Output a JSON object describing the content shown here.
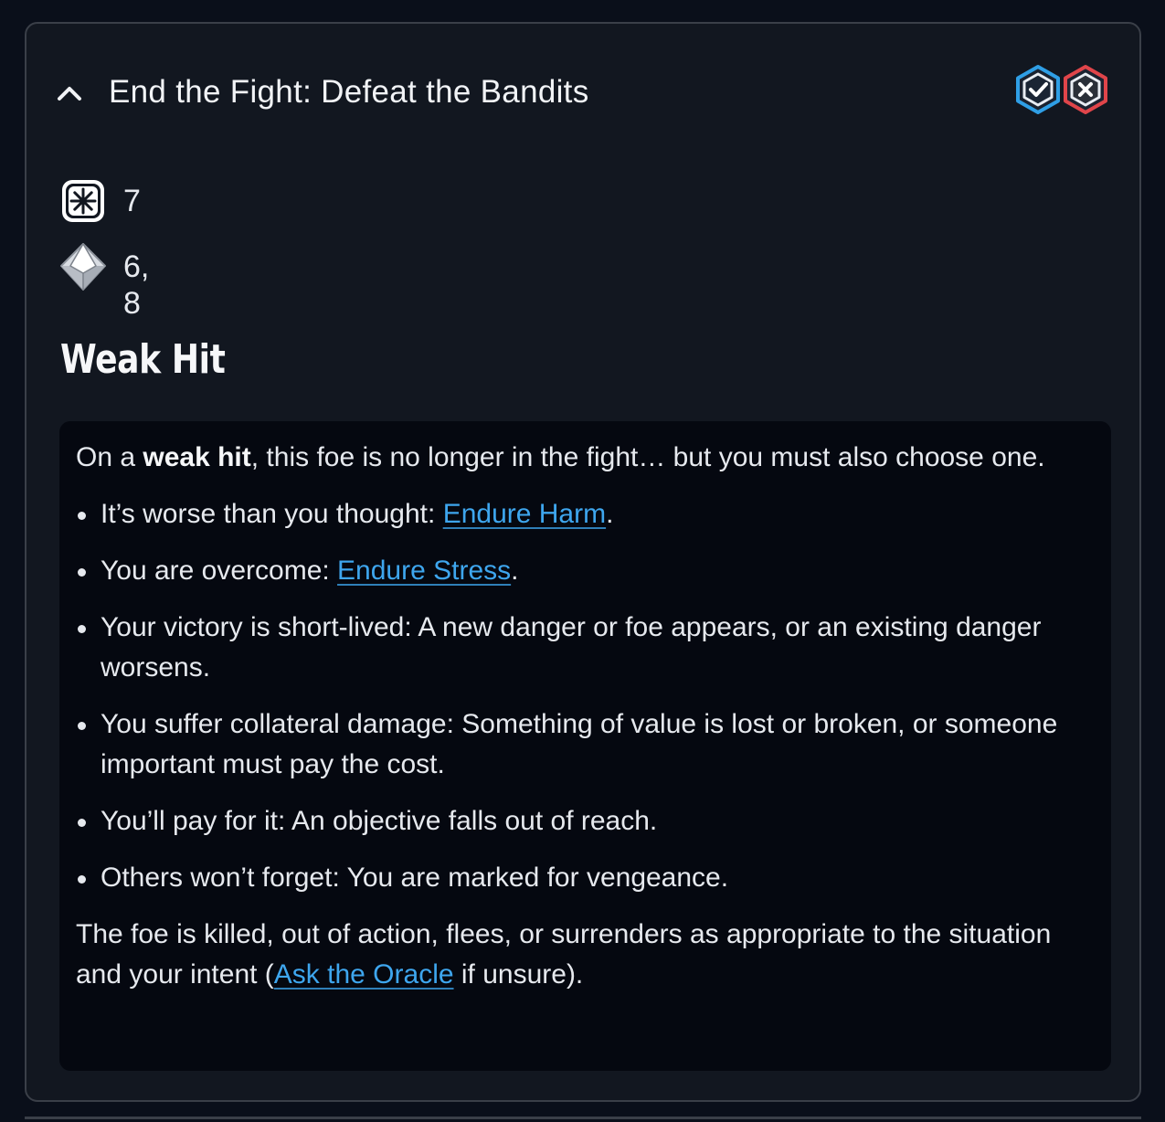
{
  "move": {
    "title": "End the Fight: Defeat the Bandits"
  },
  "actions": {
    "confirm_icon": "hex-check-icon",
    "dismiss_icon": "hex-x-icon",
    "confirm_color": "#2f9fe6",
    "dismiss_color": "#e0454a"
  },
  "roll": {
    "action_die_icon": "action-die-icon",
    "action_value": "7",
    "challenge_die_icon": "challenge-die-icon",
    "challenge_values": "6, 8"
  },
  "outcome": {
    "heading": "Weak Hit",
    "intro_prefix": "On a ",
    "intro_bold": "weak hit",
    "intro_suffix": ", this foe is no longer in the fight… but you must also choose one.",
    "options": [
      {
        "text": "It’s worse than you thought: ",
        "link": "Endure Harm",
        "after": "."
      },
      {
        "text": "You are overcome: ",
        "link": "Endure Stress",
        "after": "."
      },
      {
        "text": "Your victory is short-lived: A new danger or foe appears, or an existing danger worsens."
      },
      {
        "text": "You suffer collateral damage: Something of value is lost or broken, or someone important must pay the cost."
      },
      {
        "text": "You’ll pay for it: An objective falls out of reach."
      },
      {
        "text": "Others won’t forget: You are marked for vengeance."
      }
    ],
    "outro_prefix": "The foe is killed, out of action, flees, or surrenders as appropriate to the situation and your intent (",
    "outro_link": "Ask the Oracle",
    "outro_suffix": " if unsure)."
  },
  "colors": {
    "link": "#3ea6ee",
    "background": "#0a0f1a",
    "card": "#121720",
    "panel": "#050810"
  }
}
